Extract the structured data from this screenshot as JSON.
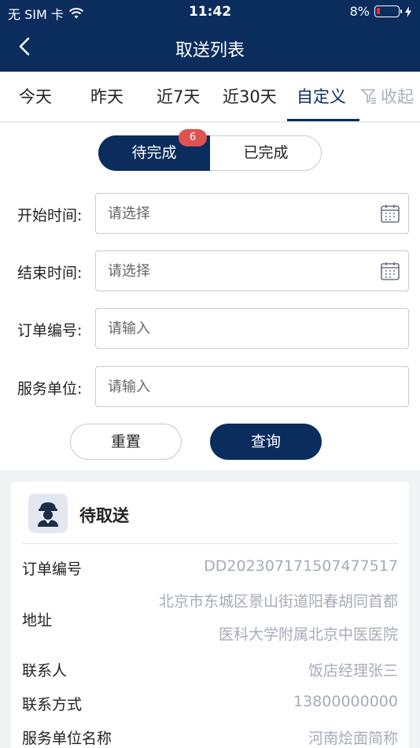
{
  "status_bar": {
    "carrier": "无 SIM 卡",
    "time": "11:42",
    "battery": "8%"
  },
  "navbar": {
    "title": "取送列表"
  },
  "date_tabs": {
    "items": [
      "今天",
      "昨天",
      "近7天",
      "近30天",
      "自定义"
    ],
    "active_index": 4,
    "collapse_label": "收起"
  },
  "segment": {
    "pending_label": "待完成",
    "pending_count": "6",
    "done_label": "已完成"
  },
  "filters": {
    "start_time": {
      "label": "开始时间:",
      "placeholder": "请选择"
    },
    "end_time": {
      "label": "结束时间:",
      "placeholder": "请选择"
    },
    "order_no": {
      "label": "订单编号:",
      "placeholder": "请输入"
    },
    "service_unit": {
      "label": "服务单位:",
      "placeholder": "请输入"
    }
  },
  "actions": {
    "reset_label": "重置",
    "query_label": "查询"
  },
  "order_card": {
    "status": "待取送",
    "fields": {
      "order_no_label": "订单编号",
      "order_no_value": "DD20230717150747751​7",
      "address_label": "地址",
      "address_line1": "北京市东城区景山街道阳春胡同首都",
      "address_line2": "医科大学附属北京中医医院",
      "contact_label": "联系人",
      "contact_value": "饭店经理张三",
      "phone_label": "联系方式",
      "phone_value": "13800000000",
      "unit_label": "服务单位名称",
      "unit_value": "河南烩面简称"
    }
  },
  "colors": {
    "primary": "#0a2d5e",
    "badge": "#e05252",
    "muted_text": "#a6abb8"
  }
}
